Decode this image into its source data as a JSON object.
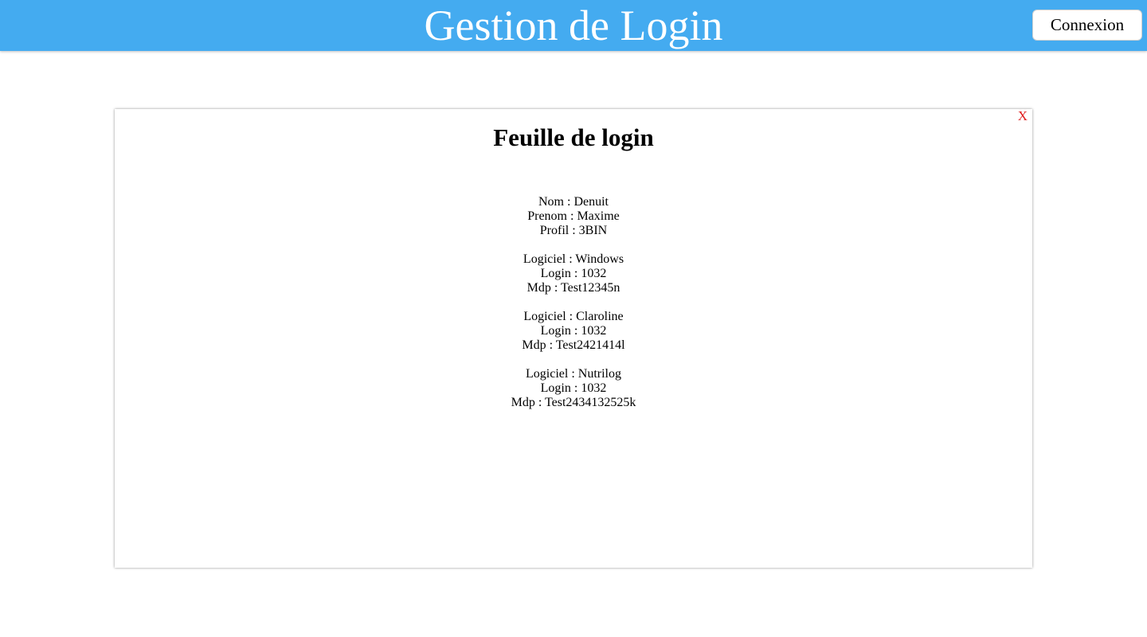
{
  "header": {
    "title": "Gestion de Login",
    "connect_label": "Connexion"
  },
  "card": {
    "close_label": "X",
    "title": "Feuille de login",
    "user": {
      "nom": "Nom : Denuit",
      "prenom": "Prenom : Maxime",
      "profil": "Profil : 3BIN"
    },
    "logins": [
      {
        "logiciel": "Logiciel : Windows",
        "login": "Login : 1032",
        "mdp": "Mdp : Test12345n"
      },
      {
        "logiciel": "Logiciel : Claroline",
        "login": "Login : 1032",
        "mdp": "Mdp : Test2421414l"
      },
      {
        "logiciel": "Logiciel : Nutrilog",
        "login": "Login : 1032",
        "mdp": "Mdp : Test2434132525k"
      }
    ]
  },
  "colors": {
    "header_bg": "#44abf0",
    "close_color": "#e02020"
  }
}
